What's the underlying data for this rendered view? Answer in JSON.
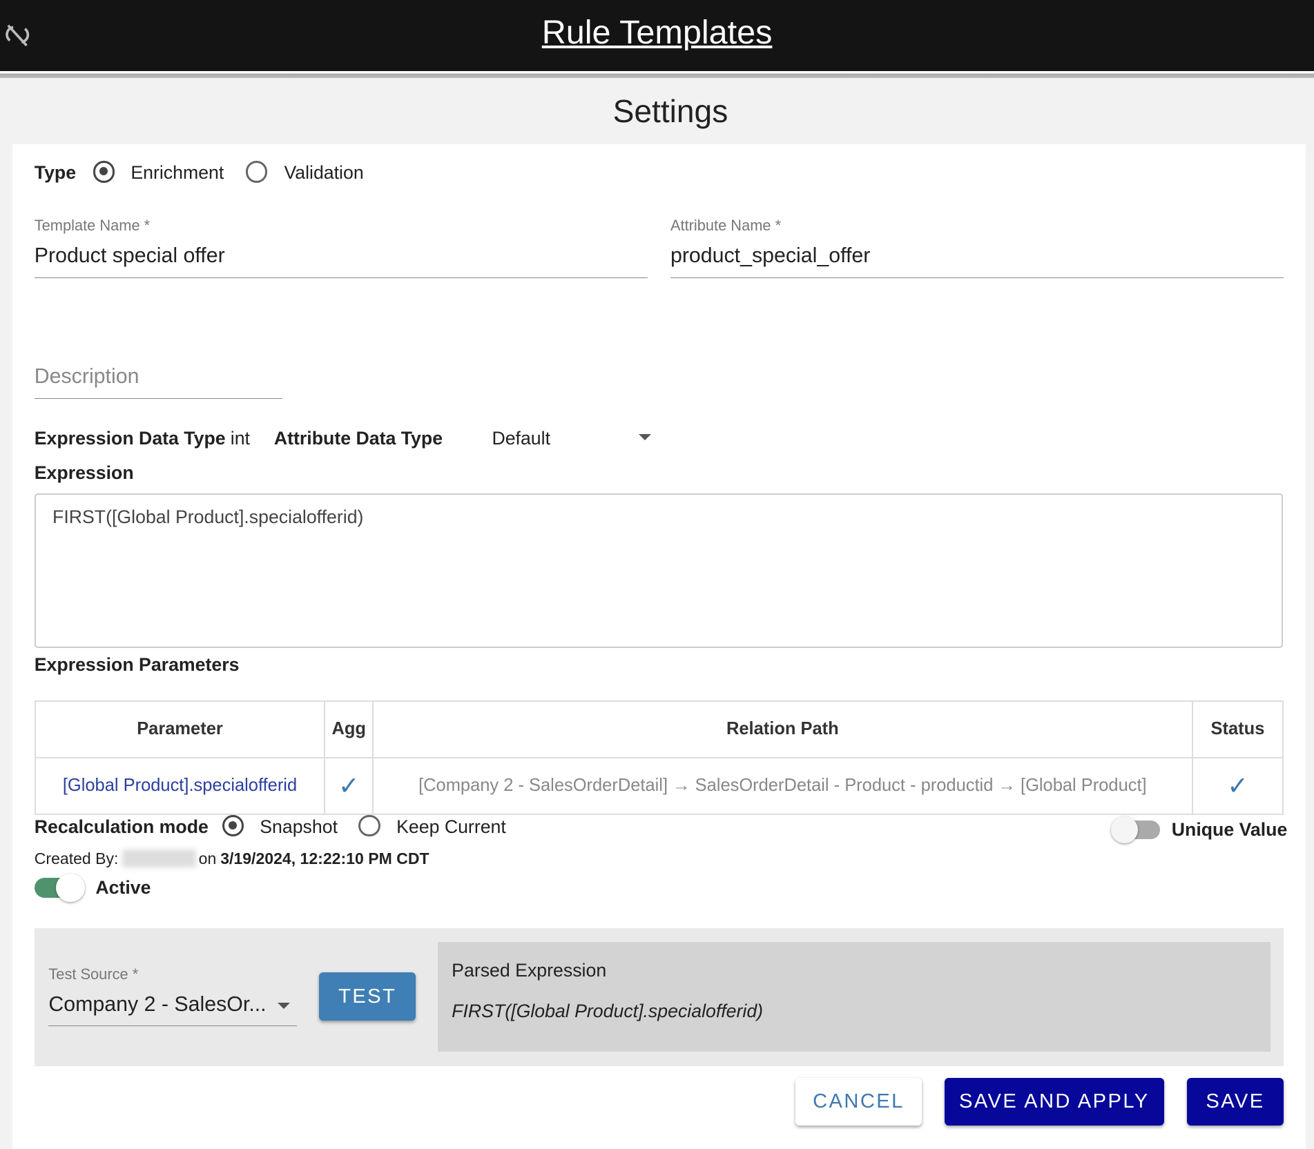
{
  "header": {
    "title": "Rule Templates",
    "sync_icon": "sync-disabled-icon"
  },
  "page_title": "Settings",
  "type": {
    "label": "Type",
    "options": [
      "Enrichment",
      "Validation"
    ],
    "selected": "Enrichment"
  },
  "template_name": {
    "label": "Template Name *",
    "value": "Product special offer"
  },
  "attribute_name": {
    "label": "Attribute Name *",
    "value": "product_special_offer"
  },
  "description": {
    "placeholder": "Description"
  },
  "expression_data_type": {
    "label": "Expression Data Type",
    "value": "int"
  },
  "attribute_data_type": {
    "label": "Attribute Data Type",
    "value": "Default"
  },
  "expression": {
    "label": "Expression",
    "value": "FIRST([Global Product].specialofferid)"
  },
  "parameters": {
    "label": "Expression Parameters",
    "columns": [
      "Parameter",
      "Agg",
      "Relation Path",
      "Status"
    ],
    "rows": [
      {
        "parameter": "[Global Product].specialofferid",
        "agg": "✓",
        "relation_path": "[Company 2 - SalesOrderDetail] → SalesOrderDetail - Product - productid → [Global Product]",
        "status": "✓"
      }
    ]
  },
  "recalculation": {
    "label": "Recalculation mode",
    "options": [
      "Snapshot",
      "Keep Current"
    ],
    "selected": "Snapshot"
  },
  "unique_value": {
    "label": "Unique Value",
    "on": false
  },
  "created": {
    "label": "Created By:",
    "on": "on",
    "date": "3/19/2024, 12:22:10 PM CDT"
  },
  "active": {
    "label": "Active",
    "on": true
  },
  "test": {
    "source_label": "Test Source *",
    "source_value": "Company 2 - SalesOr...",
    "button": "TEST",
    "parsed_label": "Parsed Expression",
    "parsed_value": "FIRST([Global Product].specialofferid)"
  },
  "actions": {
    "cancel": "CANCEL",
    "save_apply": "SAVE AND APPLY",
    "save": "SAVE"
  },
  "colors": {
    "primary": "#07079a",
    "test": "#3f7fb5",
    "toggle": "#4f936d"
  }
}
